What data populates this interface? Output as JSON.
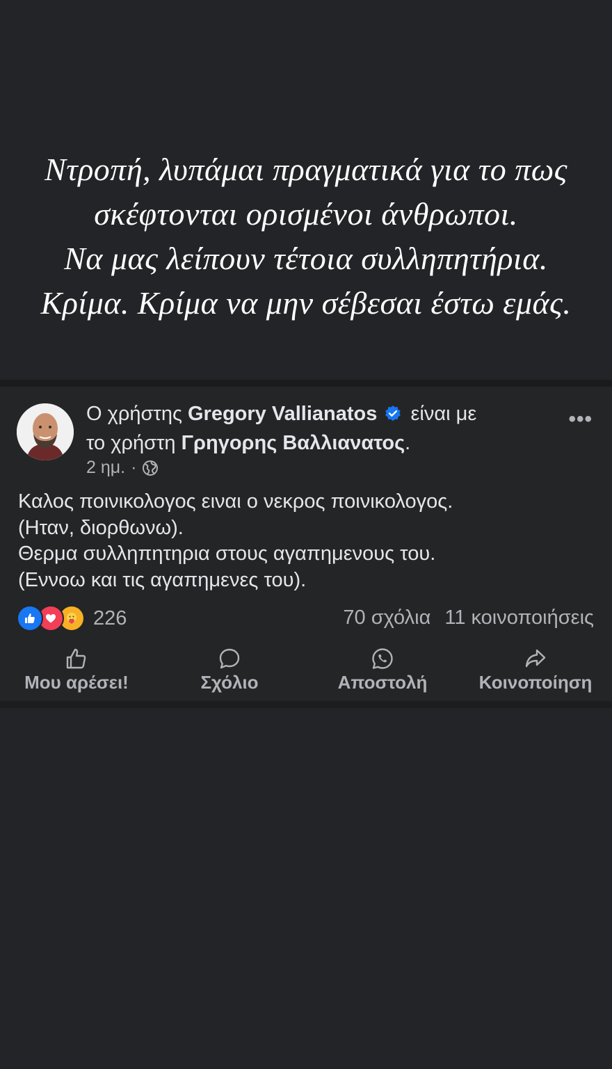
{
  "caption": {
    "lines": [
      "Ντροπή, λυπάμαι πραγματικά για το πως",
      "σκέφτονται ορισμένοι άνθρωποι.",
      "Να μας λείπουν τέτοια συλληπητήρια.",
      "Κρίμα. Κρίμα να μην σέβεσαι έστω εμάς."
    ]
  },
  "post": {
    "header": {
      "prefix": "Ο χρήστης",
      "author": "Gregory Vallianatos",
      "with_text": "είναι με",
      "with_prefix": "το χρήστη",
      "tagged": "Γρηγορης Βαλλιανατος",
      "suffix": "."
    },
    "meta": {
      "time": "2 ημ.",
      "separator": "·",
      "privacy_icon": "globe-icon"
    },
    "more_label": "•••",
    "body_lines": [
      "Καλος ποινικολογος ειναι ο νεκρος ποινικολογος.",
      "(Ηταν, διορθωνω).",
      "Θερμα συλληπητηρια στους αγαπημενους του.",
      "(Εννοω και τις αγαπημενες του)."
    ],
    "reactions": {
      "types": [
        "like-icon",
        "love-icon",
        "care-icon"
      ],
      "count": "226"
    },
    "stats": {
      "comments": "70 σχόλια",
      "shares": "11 κοινοποιήσεις"
    },
    "actions": {
      "like": "Μου αρέσει!",
      "comment": "Σχόλιο",
      "send": "Αποστολή",
      "share": "Κοινοποίηση"
    }
  },
  "colors": {
    "background": "#232427",
    "card": "#242526",
    "text": "#e4e6eb",
    "muted": "#b0b3b8",
    "accent": "#1877f2",
    "love": "#f33e58",
    "care": "#f7b125"
  }
}
